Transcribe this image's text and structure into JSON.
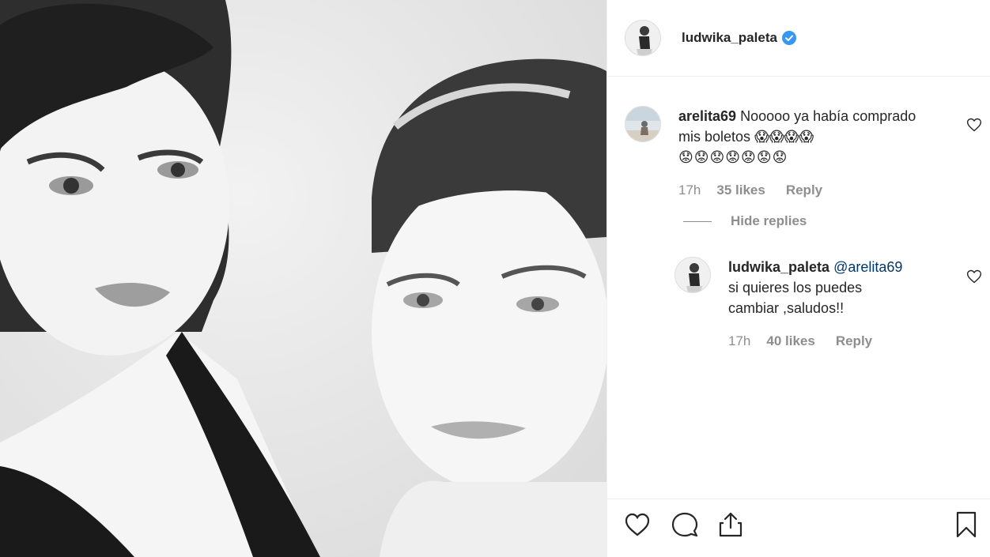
{
  "post": {
    "username": "ludwika_paleta",
    "verified": true
  },
  "comments": [
    {
      "username": "arelita69",
      "text": "Nooooo ya había comprado mis boletos",
      "emoji_inline": "😱😱😱😱",
      "emoji_line": "😟😟😟😟😟😟😟",
      "time": "17h",
      "likes": "35 likes",
      "reply_label": "Reply",
      "hide_replies_label": "Hide replies",
      "replies": [
        {
          "username": "ludwika_paleta",
          "mention": "@arelita69",
          "text_line1": "si quieres los puedes",
          "text_line2": "cambiar ,saludos!!",
          "time": "17h",
          "likes": "40 likes",
          "reply_label": "Reply"
        }
      ]
    }
  ],
  "icons": {
    "like": "heart-icon",
    "comment": "comment-icon",
    "share": "share-icon",
    "save": "bookmark-icon",
    "verified": "verified-badge-icon"
  },
  "colors": {
    "verified": "#3897f0",
    "text": "#262626",
    "muted": "#8e8e8e",
    "mention": "#00376b"
  }
}
